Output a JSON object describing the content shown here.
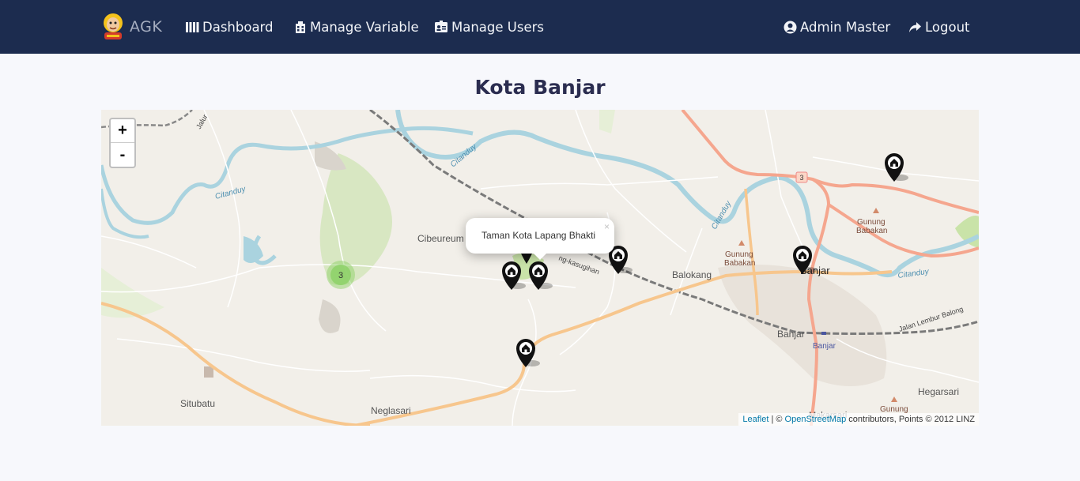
{
  "brand": {
    "name": "AGK",
    "logo_icon": "avatar-logo-icon"
  },
  "nav": {
    "dashboard": {
      "label": "Dashboard",
      "icon": "map-icon"
    },
    "manage_variable": {
      "label": "Manage Variable",
      "icon": "building-icon"
    },
    "manage_users": {
      "label": "Manage Users",
      "icon": "id-badge-icon"
    },
    "admin": {
      "label": "Admin Master",
      "icon": "user-circle-icon"
    },
    "logout": {
      "label": "Logout",
      "icon": "share-arrow-icon"
    }
  },
  "page": {
    "title": "Kota Banjar"
  },
  "map": {
    "zoom_in": "+",
    "zoom_out": "-",
    "popup": {
      "text": "Taman Kota Lapang Bhakti",
      "close": "×"
    },
    "cluster": {
      "count": "3"
    },
    "labels": {
      "cibeureum": "Cibeureum",
      "balokang": "Balokang",
      "banjar": "Banjar",
      "banjar2": "Banjar",
      "banjar_station": "Banjar",
      "situbatu": "Situbatu",
      "neglasari": "Neglasari",
      "hegarsari": "Hegarsari",
      "gunung_babakan_line1": "Gunung",
      "gunung_babakan_line2": "Babakan",
      "gunung_babakan2_line1": "Gunung",
      "gunung_babakan2_line2": "Babakan",
      "gunung_bottom": "Gunung",
      "makarsari": "Makarsari",
      "citanduy1": "Citanduy",
      "citanduy2": "Citanduy",
      "citanduy3": "Citanduy",
      "citanduy4": "Citanduy",
      "jalan_lembur_balong": "Jalan Lembur Balong",
      "jalur": "Jalur",
      "kasugihan": "ng-kasugihan",
      "road_shield": "3"
    },
    "attribution": {
      "leaflet": "Leaflet",
      "sep": " | © ",
      "osm": "OpenStreetMap",
      "rest": " contributors, Points © 2012 LINZ"
    },
    "colors": {
      "land": "#f2efe9",
      "water": "#aad3df",
      "primary_road": "#f5a68e",
      "secondary_road": "#f7c68d",
      "park": "#d8e7c2",
      "marker": "#111111",
      "cluster": "#8fd16a"
    }
  }
}
